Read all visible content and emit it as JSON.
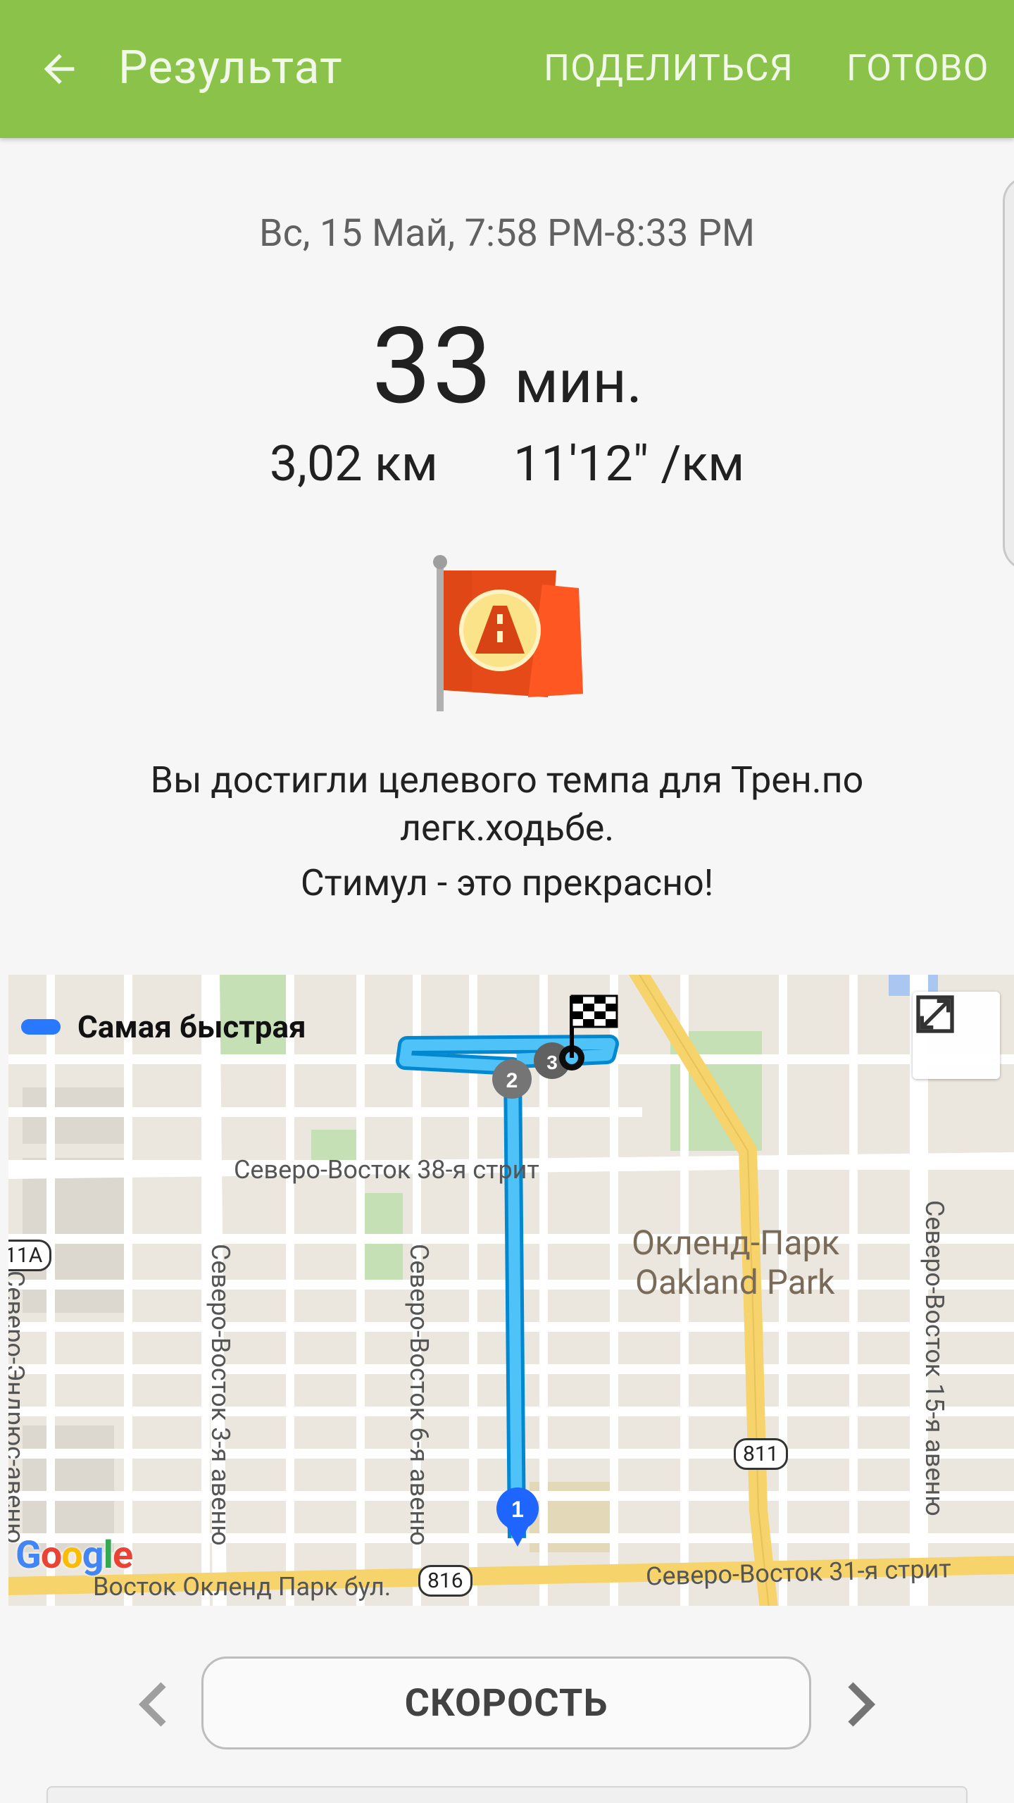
{
  "appbar": {
    "title": "Результат",
    "share_label": "ПОДЕЛИТЬСЯ",
    "done_label": "ГОТОВО"
  },
  "summary": {
    "datetime": "Вс, 15 Май, 7:58 PM-8:33 PM",
    "duration_value": "33",
    "duration_unit": "мин.",
    "distance": "3,02 км",
    "pace": "11'12\" /км"
  },
  "achievement": {
    "line1": "Вы достигли целевого темпа для Трен.по легк.ходьбе.",
    "line2": "Стимул - это прекрасно!"
  },
  "map": {
    "legend_label": "Самая быстрая",
    "streets": {
      "ne38": "Северо-Восток 38-я стрит",
      "ne31": "Северо-Восток 31-я стрит",
      "ne3": "Северо-Восток 3-я авеню",
      "ne6": "Северо-Восток 6-я авеню",
      "ne15": "Северо-Восток 15-я авеню",
      "andrews": "Северо-Эндрюс-авеню",
      "oakland_blvd": "Восток Окленд Парк бул."
    },
    "district_ru": "Окленд-Парк",
    "district_en": "Oakland Park",
    "shields": {
      "r811": "811",
      "r816": "816",
      "r11a": "11A"
    },
    "markers": [
      "1",
      "2",
      "3"
    ],
    "google_logo": "Google"
  },
  "chart_selector": {
    "label": "СКОРОСТЬ"
  }
}
